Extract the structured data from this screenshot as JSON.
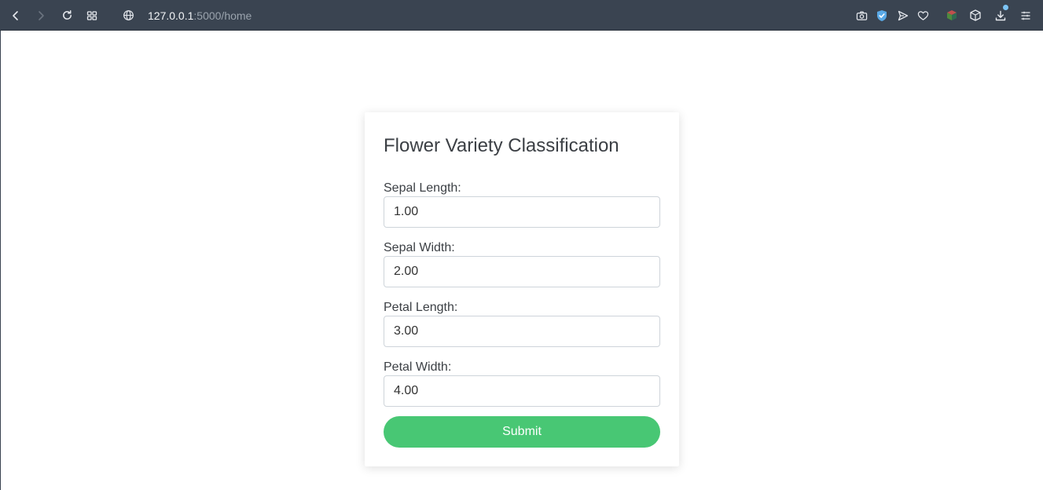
{
  "browser": {
    "url_host": "127.0.0.1",
    "url_rest": ":5000/home",
    "download_badge_color": "#7cc4f5",
    "icons": [
      "back-icon",
      "forward-icon",
      "reload-icon",
      "tab-grid-icon",
      "globe-icon",
      "camera-icon",
      "shield-icon",
      "send-icon",
      "heart-icon",
      "extension-cube-icon",
      "box-icon",
      "download-icon",
      "menu-icon"
    ]
  },
  "form": {
    "title": "Flower Variety Classification",
    "fields": [
      {
        "label": "Sepal Length:",
        "value": "1.00"
      },
      {
        "label": "Sepal Width:",
        "value": "2.00"
      },
      {
        "label": "Petal Length:",
        "value": "3.00"
      },
      {
        "label": "Petal Width:",
        "value": "4.00"
      }
    ],
    "submit_label": "Submit",
    "submit_color": "#48c774"
  }
}
